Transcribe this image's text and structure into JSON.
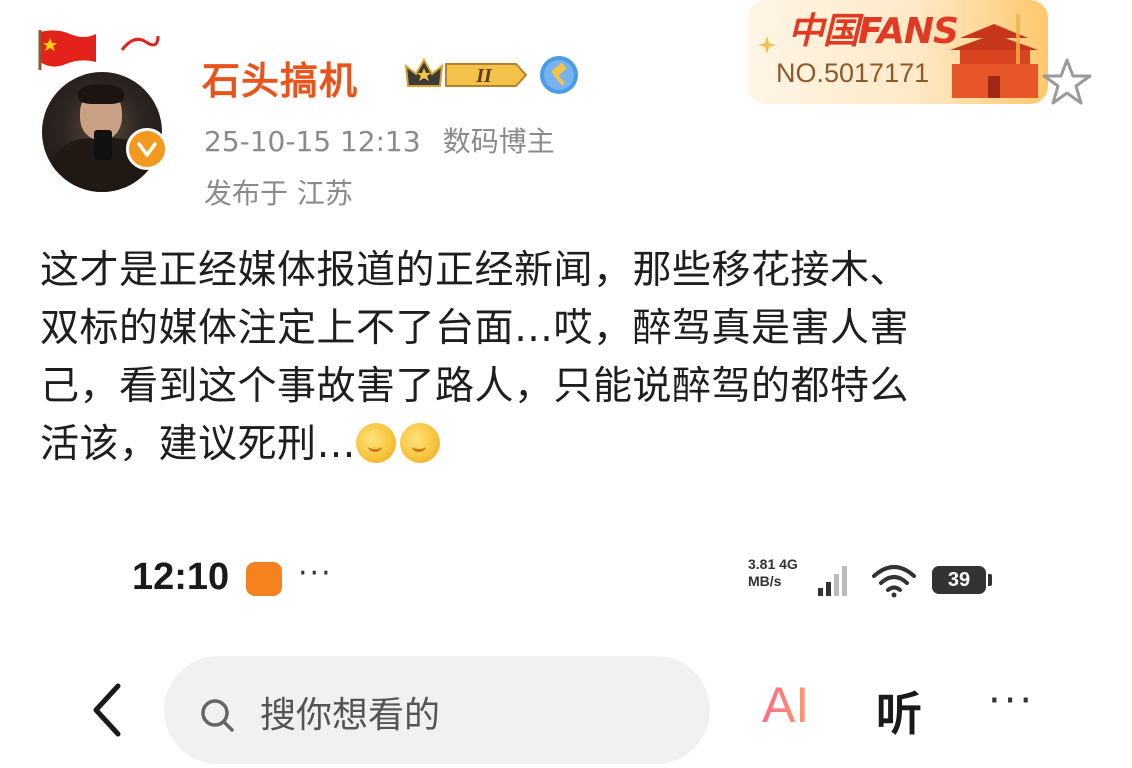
{
  "post": {
    "user": {
      "name": "石头搞机",
      "level_badge": "II",
      "avatar_icon": "avatar-photo"
    },
    "meta": {
      "datetime": "25-10-15 12:13",
      "role": "数码博主",
      "location": "发布于 江苏"
    },
    "fans_card": {
      "logo": "中国FANS",
      "number": "NO.5017171"
    },
    "body": {
      "line1": "这才是正经媒体报道的正经新闻，那些移花接木、",
      "line2": "双标的媒体注定上不了台面…哎，醉驾真是害人害",
      "line3": "己，看到这个事故害了路人，只能说醉驾的都特么",
      "line4": "活该，建议死刑…"
    }
  },
  "screenshot_statusbar": {
    "time": "12:10",
    "dots": "···",
    "speed_value": "3.81",
    "speed_unit": "MB/s",
    "network": "4G",
    "battery": "39"
  },
  "search_bar": {
    "back_icon": "chevron-left-icon",
    "placeholder": "搜你想看的",
    "ai_label": "AI",
    "listen_label": "听",
    "more_label": "···"
  },
  "colors": {
    "username": "#e8541c",
    "meta_gray": "#8a8a8a",
    "verified_badge": "#f39a1e"
  }
}
